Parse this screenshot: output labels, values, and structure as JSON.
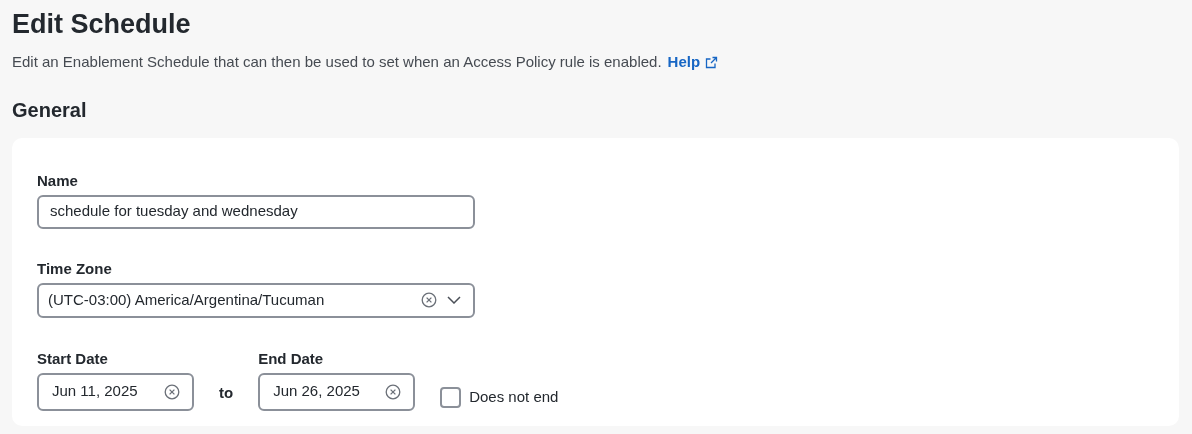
{
  "title": "Edit Schedule",
  "description": {
    "text": "Edit an Enablement Schedule that can then be used to set when an Access Policy rule is enabled.",
    "link": "Help"
  },
  "section": "General",
  "name_field": {
    "label": "Name",
    "value": "schedule for tuesday and wednesday"
  },
  "time_zone": {
    "label": "Time Zone",
    "value": "(UTC-03:00) America/Argentina/Tucuman"
  },
  "start_date": {
    "label": "Start Date",
    "value": "Jun 11, 2025"
  },
  "separator": "to",
  "end_date": {
    "label": "End Date",
    "value": "Jun 26, 2025"
  },
  "does_not_end": {
    "label": "Does not end",
    "checked": false
  }
}
